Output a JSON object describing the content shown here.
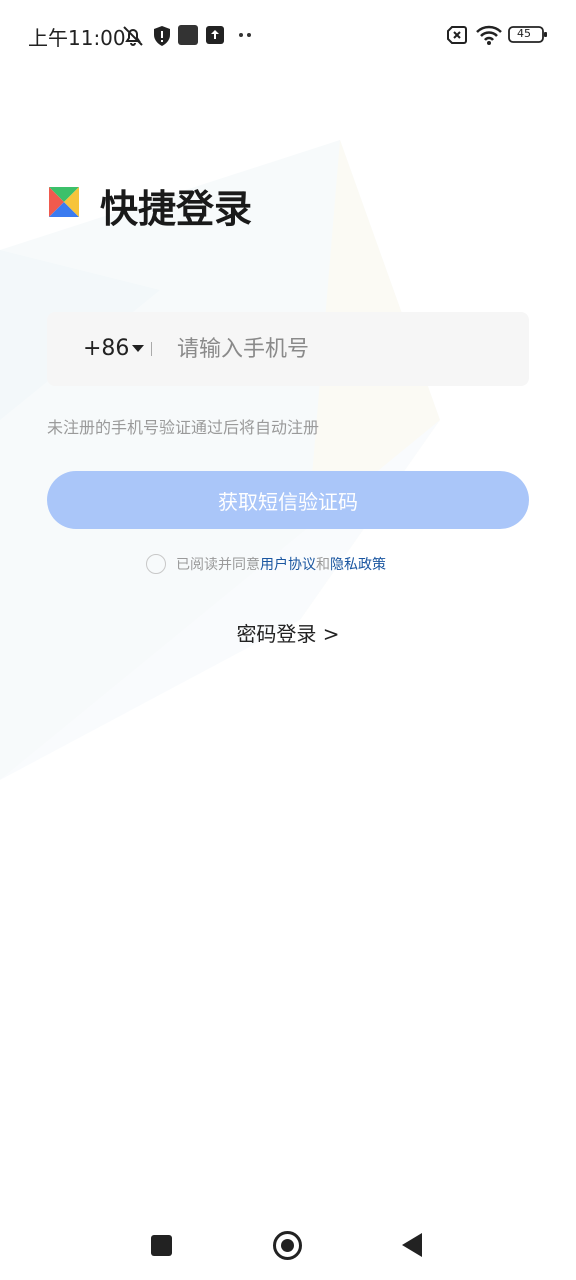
{
  "status_bar": {
    "time": "上午11:00",
    "battery_level": "45",
    "icons": [
      "mute-bell-icon",
      "shield-alert-icon",
      "square-notification-icon",
      "upload-notification-icon",
      "more-dots-icon",
      "sim-x-icon",
      "wifi-icon",
      "battery-icon"
    ]
  },
  "login": {
    "title": "快捷登录",
    "country_code": "+86",
    "phone_placeholder": "请输入手机号",
    "phone_value": "",
    "hint": "未注册的手机号验证通过后将自动注册",
    "sms_button_label": "获取短信验证码",
    "agree_prefix": "已阅读并同意",
    "user_agreement": "用户协议",
    "agree_and": "和",
    "privacy_policy": "隐私政策",
    "password_login": "密码登录 >"
  },
  "colors": {
    "button_bg": "#aac6f9",
    "link": "#1a56a0",
    "input_bg": "#f6f6f6"
  },
  "nav_bar": {
    "icons": [
      "recent-apps-icon",
      "home-icon",
      "back-icon"
    ]
  }
}
